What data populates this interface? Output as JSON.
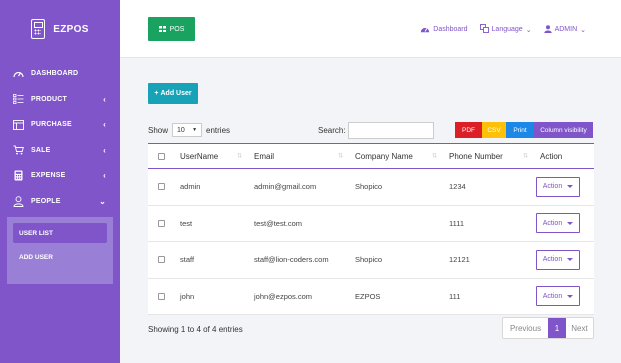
{
  "brand": {
    "name": "EZPOS"
  },
  "sidebar": {
    "items": [
      {
        "label": "DASHBOARD",
        "icon": "dashboard-icon",
        "caret": ""
      },
      {
        "label": "PRODUCT",
        "icon": "list-icon",
        "caret": "‹"
      },
      {
        "label": "PURCHASE",
        "icon": "card-icon",
        "caret": "‹"
      },
      {
        "label": "SALE",
        "icon": "cart-icon",
        "caret": "‹"
      },
      {
        "label": "EXPENSE",
        "icon": "calculator-icon",
        "caret": "‹"
      },
      {
        "label": "PEOPLE",
        "icon": "user-icon",
        "caret": "⌄"
      }
    ],
    "submenu": [
      {
        "label": "USER LIST",
        "active": true
      },
      {
        "label": "ADD USER",
        "active": false
      }
    ]
  },
  "topbar": {
    "pos_label": "POS",
    "dashboard_label": "Dashboard",
    "language_label": "Language",
    "admin_label": "ADMIN"
  },
  "toolbar": {
    "add_user_label": "Add User",
    "show_label": "Show",
    "entries_value": "10",
    "entries_label": "entries",
    "search_label": "Search:",
    "search_value": "",
    "pdf_label": "PDF",
    "csv_label": "CSV",
    "print_label": "Print",
    "colvis_label": "Column visibility"
  },
  "table": {
    "headers": [
      "UserName",
      "Email",
      "Company Name",
      "Phone Number",
      "Action"
    ],
    "rows": [
      {
        "username": "admin",
        "email": "admin@gmail.com",
        "company": "Shopico",
        "phone": "1234",
        "action": "Action"
      },
      {
        "username": "test",
        "email": "test@test.com",
        "company": "",
        "phone": "1111",
        "action": "Action"
      },
      {
        "username": "staff",
        "email": "staff@lion-coders.com",
        "company": "Shopico",
        "phone": "12121",
        "action": "Action"
      },
      {
        "username": "john",
        "email": "john@ezpos.com",
        "company": "EZPOS",
        "phone": "111",
        "action": "Action"
      }
    ]
  },
  "footer": {
    "info": "Showing 1 to 4 of 4 entries",
    "prev_label": "Previous",
    "page": "1",
    "next_label": "Next"
  },
  "colors": {
    "primary": "#7f55c9",
    "pos": "#1aa260",
    "add": "#17a2b8",
    "pdf": "#dc1f26",
    "csv": "#ffc107",
    "print": "#1b87e6"
  }
}
